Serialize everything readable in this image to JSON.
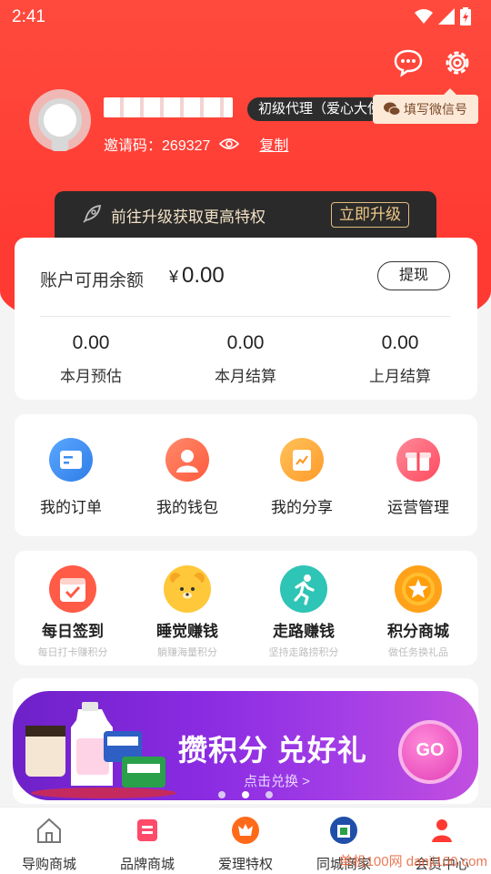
{
  "status": {
    "time": "2:41"
  },
  "profile": {
    "level": "初级代理（爱心大使）",
    "invite_label": "邀请码：",
    "invite_code": "269327",
    "copy_label": "复制",
    "wechat_tip": "填写微信号"
  },
  "upgrade": {
    "text": "前往升级获取更高特权",
    "button": "立即升级"
  },
  "balance": {
    "label": "账户可用余额",
    "currency": "¥",
    "amount": "0.00",
    "withdraw": "提现",
    "stats": [
      {
        "value": "0.00",
        "label": "本月预估"
      },
      {
        "value": "0.00",
        "label": "本月结算"
      },
      {
        "value": "0.00",
        "label": "上月结算"
      }
    ]
  },
  "shortcuts": [
    {
      "label": "我的订单",
      "icon": "order-icon",
      "color": "#3d8ef0"
    },
    {
      "label": "我的钱包",
      "icon": "wallet-icon",
      "color": "#ff6a4d"
    },
    {
      "label": "我的分享",
      "icon": "share-icon",
      "color": "#ffa43a"
    },
    {
      "label": "运营管理",
      "icon": "gift-icon",
      "color": "#ff5a6a"
    }
  ],
  "tasks": [
    {
      "title": "每日签到",
      "subtitle": "每日打卡赚积分",
      "icon": "calendar-icon"
    },
    {
      "title": "睡觉赚钱",
      "subtitle": "躺赚海量积分",
      "icon": "bear-icon"
    },
    {
      "title": "走路赚钱",
      "subtitle": "坚持走路捞积分",
      "icon": "running-icon"
    },
    {
      "title": "积分商城",
      "subtitle": "做任务换礼品",
      "icon": "star-coin-icon"
    }
  ],
  "banner": {
    "title": "攒积分 兑好礼",
    "subtitle": "点击兑换 >",
    "go": "GO"
  },
  "nav": [
    {
      "label": "导购商城",
      "icon": "home-icon"
    },
    {
      "label": "品牌商城",
      "icon": "brand-icon"
    },
    {
      "label": "爱理特权",
      "icon": "privilege-icon"
    },
    {
      "label": "同城商家",
      "icon": "store-icon"
    },
    {
      "label": "会员中心",
      "icon": "member-icon"
    }
  ],
  "watermark": "单机100网 danji100.com",
  "colors": {
    "primary": "#ff3a33",
    "dark": "#2a2a2a",
    "gold": "#f1c987"
  }
}
